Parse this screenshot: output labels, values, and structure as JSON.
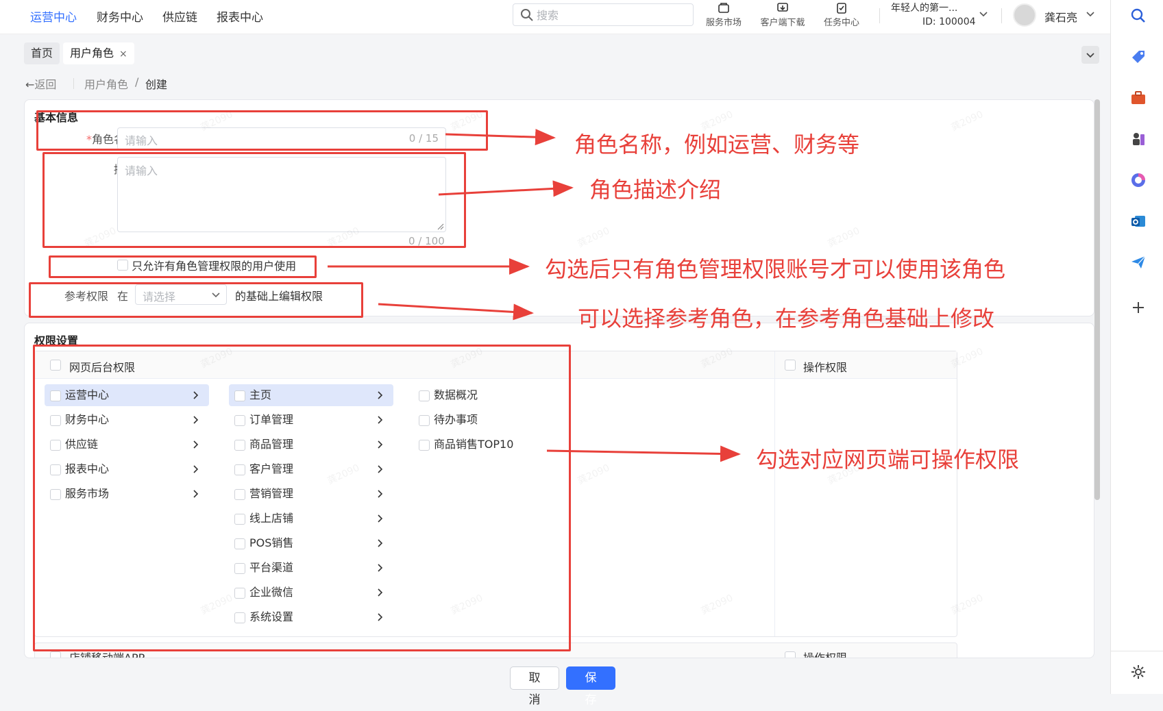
{
  "topnav": {
    "items": [
      "运营中心",
      "财务中心",
      "供应链",
      "报表中心"
    ],
    "search_placeholder": "搜索",
    "tools": [
      "服务市场",
      "客户端下载",
      "任务中心"
    ],
    "company_name": "年轻人的第一...",
    "company_id": "ID: 100004",
    "user_name": "龚石亮"
  },
  "tabs": {
    "home": "首页",
    "current": "用户角色",
    "close": "×"
  },
  "breadcrumb": {
    "back": "返回",
    "parent": "用户角色",
    "sep": "/",
    "current": "创建"
  },
  "basic_info": {
    "title": "基本信息",
    "name_required_mark": "*",
    "name_label": "角色名称",
    "name_placeholder": "请输入",
    "name_count": "0 / 15",
    "desc_label": "描述",
    "desc_placeholder": "请输入",
    "desc_count": "0 / 100",
    "restrict_label": "只允许有角色管理权限的用户使用",
    "ref_label": "参考权限",
    "ref_in": "在",
    "ref_placeholder": "请选择",
    "ref_suffix": "的基础上编辑权限"
  },
  "permissions": {
    "title": "权限设置",
    "web_header": "网页后台权限",
    "op_header": "操作权限",
    "level1": [
      "运营中心",
      "财务中心",
      "供应链",
      "报表中心",
      "服务市场"
    ],
    "level2": [
      "主页",
      "订单管理",
      "商品管理",
      "客户管理",
      "营销管理",
      "线上店铺",
      "POS销售",
      "平台渠道",
      "企业微信",
      "系统设置"
    ],
    "level3": [
      "数据概况",
      "待办事项",
      "商品销售TOP10"
    ],
    "next_section_partial": "店铺移动端APP",
    "next_op_partial": "操作权限"
  },
  "footer": {
    "cancel": "取 消",
    "save": "保 存"
  },
  "annotations": {
    "a1": "角色名称，例如运营、财务等",
    "a2": "角色描述介绍",
    "a3": "勾选后只有角色管理权限账号才可以使用该角色",
    "a4": "可以选择参考角色，在参考角色基础上修改",
    "a5": "勾选对应网页端可操作权限"
  },
  "watermark": "龚2090",
  "colors": {
    "primary": "#3370ff",
    "annotation": "#e8403a",
    "selected_row": "#dfe7fb"
  }
}
